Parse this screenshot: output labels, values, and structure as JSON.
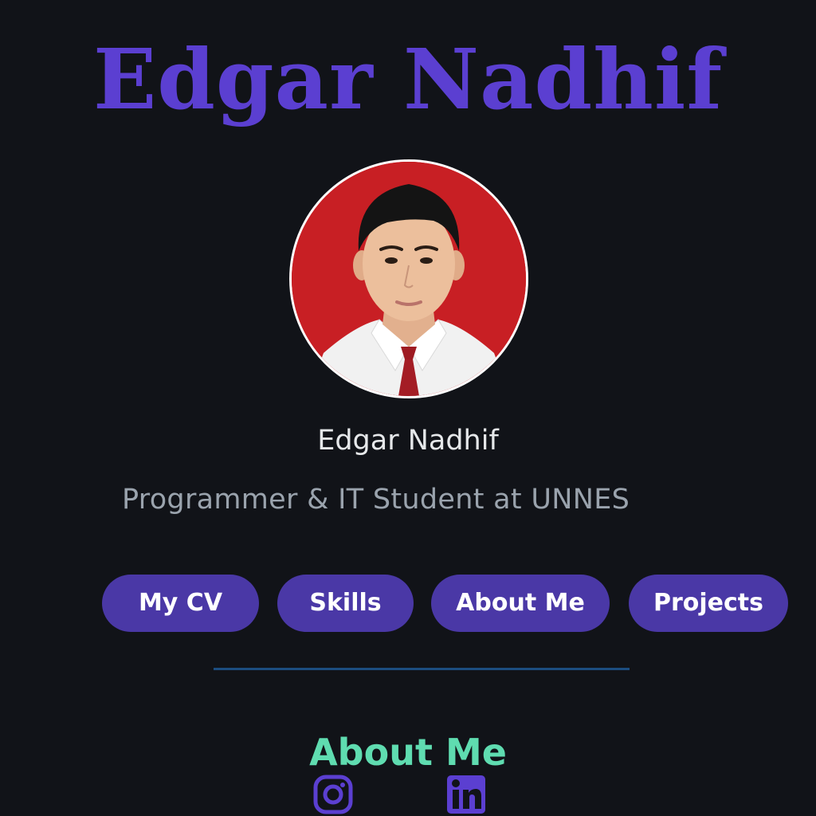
{
  "header": {
    "title": "Edgar Nadhif"
  },
  "profile": {
    "name": "Edgar Nadhif",
    "tagline": "Programmer & IT Student at UNNES",
    "photo_background": "#c81f24"
  },
  "nav": {
    "buttons": [
      {
        "label": "My CV"
      },
      {
        "label": "Skills"
      },
      {
        "label": "About Me"
      },
      {
        "label": "Projects"
      }
    ]
  },
  "about": {
    "heading": "About Me"
  },
  "social": {
    "icons": [
      "instagram-icon",
      "linkedin-icon"
    ]
  },
  "colors": {
    "background": "#111318",
    "title": "#5b3fd1",
    "button": "#4a38a6",
    "divider": "#1c4d80",
    "section_heading": "#5fdcb0",
    "icon": "#5b3fd1"
  }
}
